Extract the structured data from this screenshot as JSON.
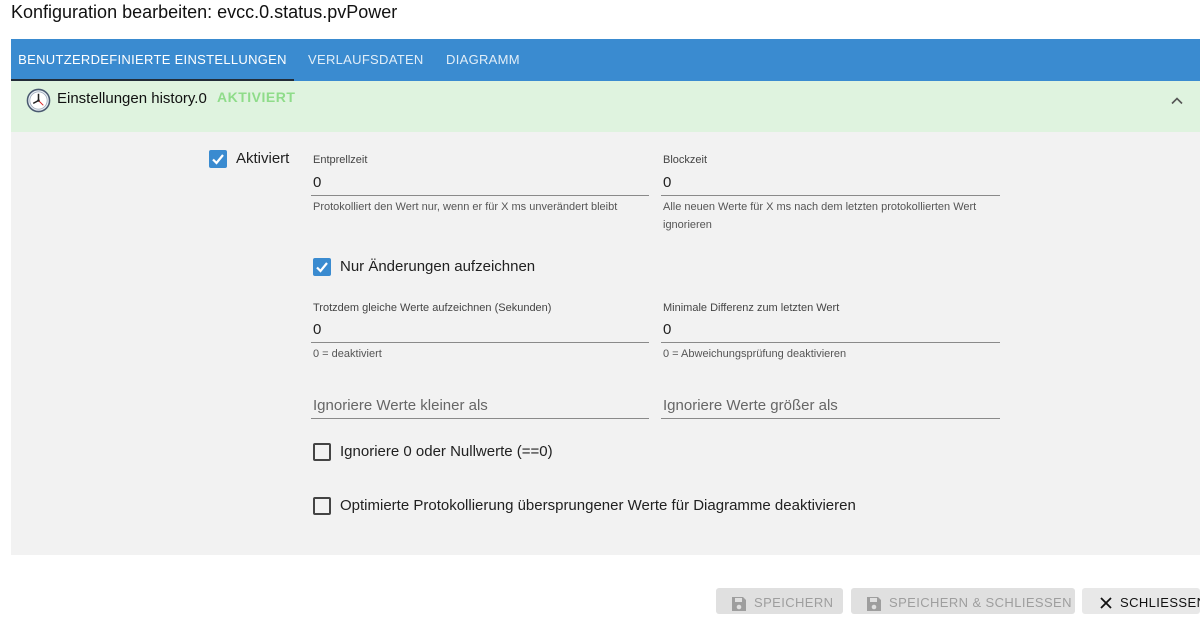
{
  "window": {
    "title": "Konfiguration bearbeiten: evcc.0.status.pvPower"
  },
  "tabs": [
    {
      "label": "Benutzerdefinierte Einstellungen"
    },
    {
      "label": "Verlaufsdaten"
    },
    {
      "label": "Diagramm"
    }
  ],
  "accordion": {
    "icon": "clock-icon",
    "label": "Einstellungen history.0",
    "status": "AKTIVIERT",
    "header_color": "#dff3df",
    "status_color": "#8fdc8a"
  },
  "settings": {
    "enabled": {
      "label": "Aktiviert",
      "checked": true
    },
    "debounce": {
      "label": "Entprellzeit",
      "value": "0",
      "helper": "Protokolliert den Wert nur, wenn er für X ms unverändert bleibt"
    },
    "blocktime": {
      "label": "Blockzeit",
      "value": "0",
      "helper": "Alle neuen Werte für X ms nach dem letzten protokollierten Wert ignorieren"
    },
    "changes_only": {
      "label": "Nur Änderungen aufzeichnen",
      "checked": true
    },
    "same_values": {
      "label": "Trotzdem gleiche Werte aufzeichnen (Sekunden)",
      "value": "0",
      "helper": "0 = deaktiviert"
    },
    "min_diff": {
      "label": "Minimale Differenz zum letzten Wert",
      "value": "0",
      "helper": "0 = Abweichungsprüfung deaktivieren"
    },
    "ignore_below": {
      "placeholder": "Ignoriere Werte kleiner als"
    },
    "ignore_above": {
      "placeholder": "Ignoriere Werte größer als"
    },
    "ignore_zero": {
      "label": "Ignoriere 0 oder Nullwerte (==0)",
      "checked": false
    },
    "disable_skipped": {
      "label": "Optimierte Protokollierung übersprungener Werte für Diagramme deaktivieren",
      "checked": false
    }
  },
  "buttons": {
    "save": "Speichern",
    "save_close": "Speichern & Schliessen",
    "close": "Schliessen"
  },
  "colors": {
    "accent": "#3a8bd0",
    "tab_indicator": "#222c38"
  }
}
